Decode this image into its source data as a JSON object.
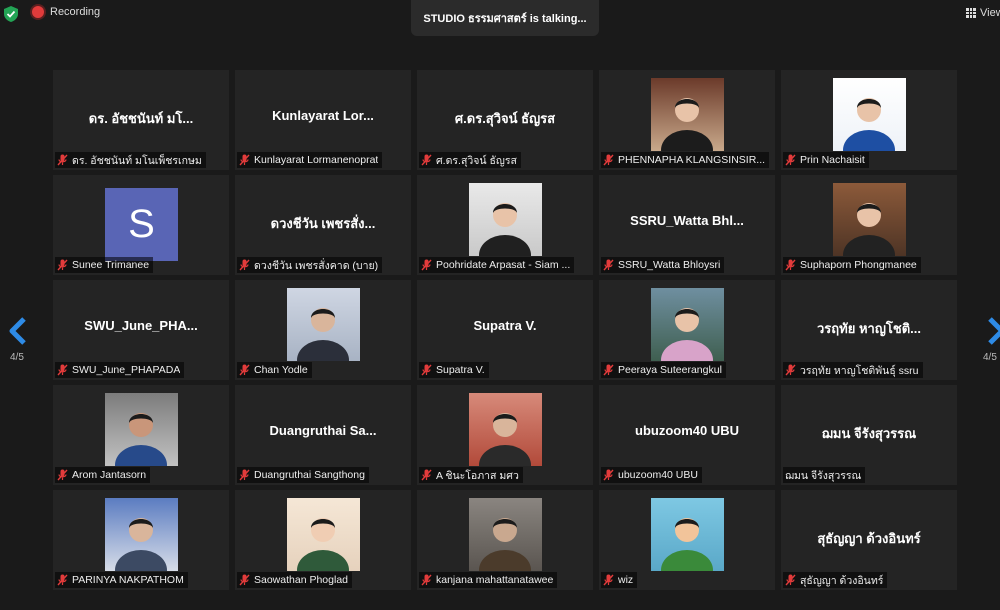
{
  "top_bar": {
    "recording_label": "Recording",
    "speaker_label": "STUDIO ธรรมศาสตร์ is  talking...",
    "view_label": "View"
  },
  "pager": {
    "left_page": "4/5",
    "right_page": "4/5"
  },
  "colors": {
    "mic_muted": "#e23b3b",
    "avatar_bg": "#5965b5",
    "arrow": "#2e8be6",
    "tile_bg": "#242424"
  },
  "participants": [
    {
      "display": "ดร. อัชชนันท์ มโ...",
      "name": "ดร. อัชชนันท์ มโนเพ็ชรเกษม"
    },
    {
      "display": "Kunlayarat  Lor...",
      "name": "Kunlayarat Lormanenoprat"
    },
    {
      "display": "ศ.ดร.สุวิจน์ ธัญรส",
      "name": "ศ.ดร.สุวิจน์ ธัญรส"
    },
    {
      "display": "",
      "name": "PHENNAPHA KLANGSINSIR..."
    },
    {
      "display": "",
      "name": "Prin Nachaisit"
    },
    {
      "display": "",
      "avatar": "S",
      "name": "Sunee Trimanee"
    },
    {
      "display": "ดวงชีวัน  เพชรสั่ง...",
      "name": "ดวงชีวัน  เพชรสั่งคาด (บาย)"
    },
    {
      "display": "",
      "name": "Poohridate Arpasat - Siam ..."
    },
    {
      "display": "SSRU_Watta  Bhl...",
      "name": "SSRU_Watta Bhloysri"
    },
    {
      "display": "",
      "name": "Suphaporn Phongmanee"
    },
    {
      "display": "SWU_June_PHA...",
      "name": "SWU_June_PHAPADA"
    },
    {
      "display": "",
      "name": "Chan Yodle"
    },
    {
      "display": "Supatra V.",
      "name": "Supatra V."
    },
    {
      "display": "",
      "name": "Peeraya Suteerangkul"
    },
    {
      "display": "วรฤทัย หาญโชติ...",
      "name": "วรฤทัย หาญโชติพันธุ์ ssru"
    },
    {
      "display": "",
      "name": "Arom Jantasorn"
    },
    {
      "display": "Duangruthai  Sa...",
      "name": "Duangruthai Sangthong"
    },
    {
      "display": "",
      "name": "A ชินะโอภาส มศว"
    },
    {
      "display": "ubuzoom40 UBU",
      "name": "ubuzoom40 UBU"
    },
    {
      "display": "ฌมน  จีรังสุวรรณ",
      "name": "ฌมน จีรังสุวรรณ",
      "unmuted": true
    },
    {
      "display": "",
      "name": "PARINYA NAKPATHOM"
    },
    {
      "display": "",
      "name": "Saowathan Phoglad"
    },
    {
      "display": "",
      "name": "kanjana mahattanatawee"
    },
    {
      "display": "",
      "name": "wiz"
    },
    {
      "display": "สุธัญญา  ด้วงอินทร์",
      "name": "สุธัญญา ด้วงอินทร์"
    }
  ]
}
